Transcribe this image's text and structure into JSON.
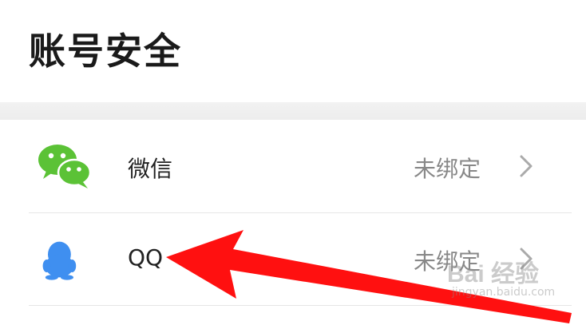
{
  "page": {
    "title": "账号安全"
  },
  "accounts": [
    {
      "label": "微信",
      "status": "未绑定",
      "icon": "wechat-icon",
      "color": "#5bc236"
    },
    {
      "label": "QQ",
      "status": "未绑定",
      "icon": "qq-icon",
      "color": "#3f8ff0"
    }
  ],
  "overlay": {
    "arrow_color": "#ff1010"
  },
  "watermark": {
    "logo": "Bai 经验",
    "url": "jingyan.baidu.com"
  }
}
